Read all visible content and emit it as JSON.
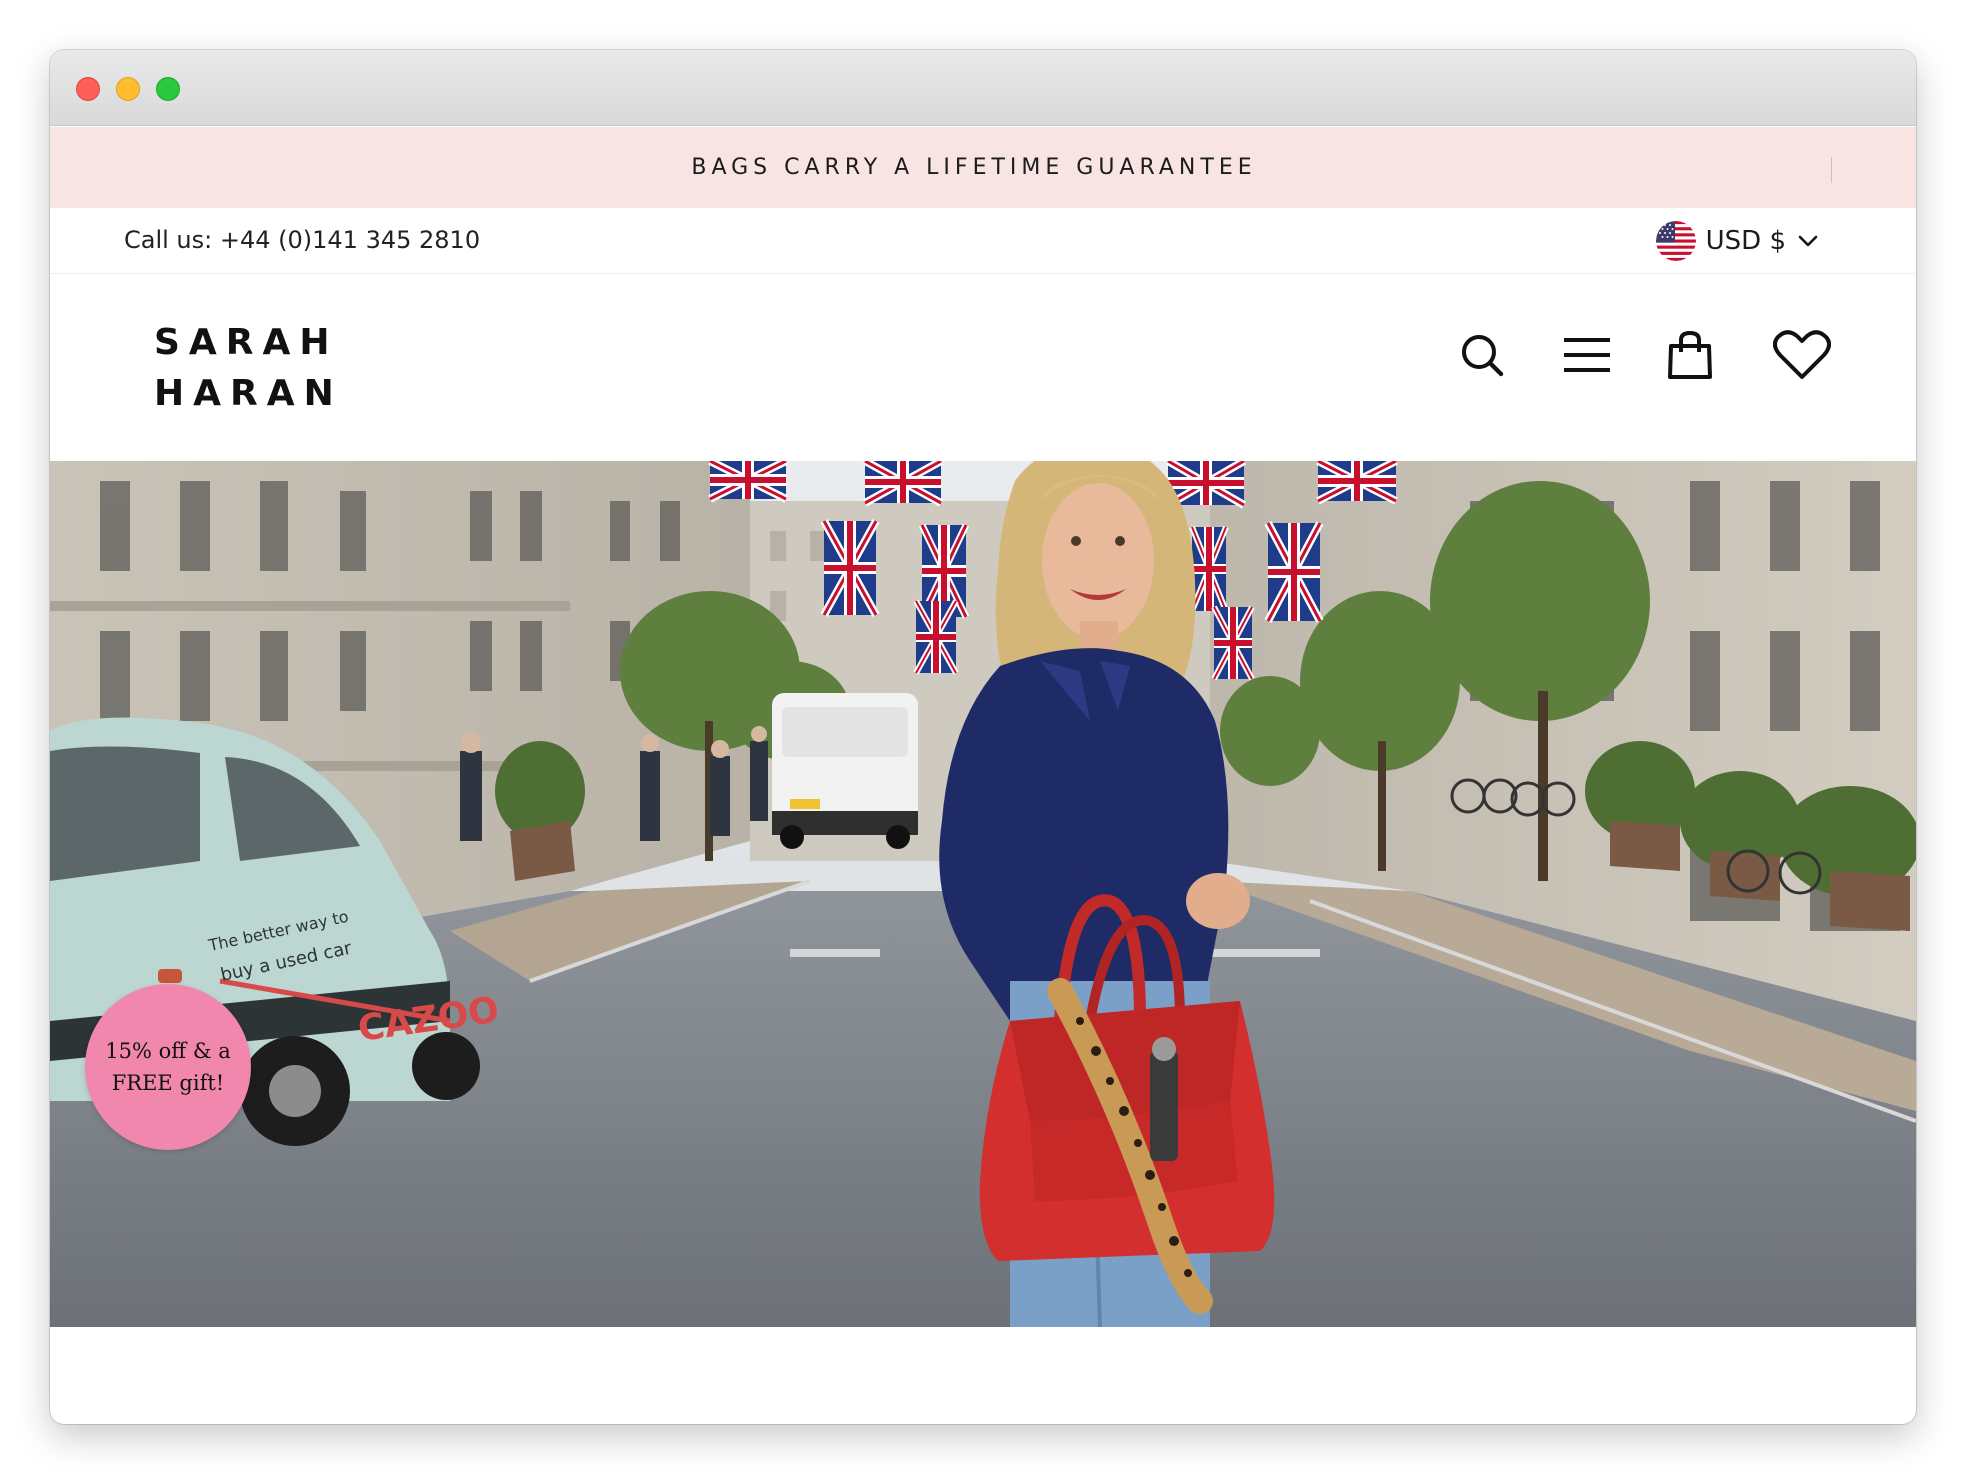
{
  "announcement": {
    "text": "BAGS CARRY A LIFETIME GUARANTEE"
  },
  "utility_bar": {
    "call_us": "Call us: +44 (0)141 345 2810",
    "currency": "USD $",
    "currency_flag": "us-flag-icon"
  },
  "header": {
    "logo_line1": "SARAH",
    "logo_line2": "HARAN",
    "icons": [
      "search-icon",
      "menu-icon",
      "shopping-bag-icon",
      "heart-icon"
    ]
  },
  "promo": {
    "line1": "15%  off & a",
    "line2": "FREE gift!",
    "color": "#f287ad"
  },
  "colors": {
    "announcement_bg": "#f8e5e3",
    "text": "#111111"
  }
}
